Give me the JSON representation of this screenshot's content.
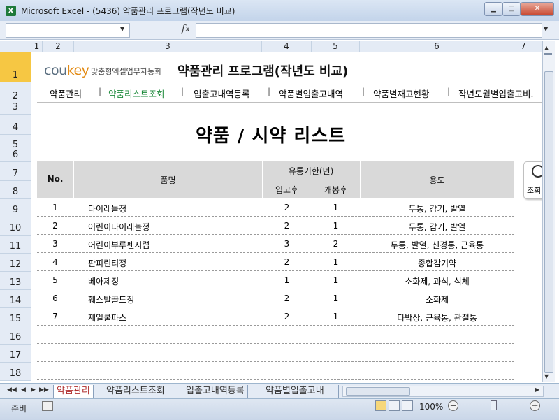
{
  "window": {
    "title": "Microsoft Excel - (5436) 약품관리 프로그램(작년도 비교)",
    "app_icon": "X",
    "min": "▁",
    "max": "□",
    "close": "✕"
  },
  "formula_bar": {
    "fx": "fx",
    "namebox": "",
    "value": ""
  },
  "columns": [
    "1",
    "2",
    "3",
    "4",
    "5",
    "6",
    "7"
  ],
  "rows": [
    "1",
    "2",
    "3",
    "4",
    "5",
    "6",
    "7",
    "8",
    "9",
    "10",
    "11",
    "12",
    "13",
    "14",
    "15",
    "16",
    "17",
    "18"
  ],
  "logo": {
    "brand_co": "cou",
    "brand_key": "key",
    "tagline": "맞춤형엑셀업무자동화"
  },
  "app_title": "약품관리 프로그램(작년도 비교)",
  "nav": [
    "약품관리",
    "약품리스트조회",
    "입출고내역등록",
    "약품별입출고내역",
    "약품별재고현황",
    "작년도월별입출고비."
  ],
  "nav_sep": "|",
  "heading": "약품 / 시약 리스트",
  "table": {
    "headers": {
      "no": "No.",
      "name": "품명",
      "expiry": "유통기한(년)",
      "after_receipt": "입고후",
      "after_open": "개봉후",
      "usage": "용도"
    },
    "rows": [
      {
        "no": "1",
        "name": "타이레놀정",
        "receipt": "2",
        "open": "1",
        "usage": "두통, 감기, 발열"
      },
      {
        "no": "2",
        "name": "어린이타이레놀정",
        "receipt": "2",
        "open": "1",
        "usage": "두통, 감기, 발열"
      },
      {
        "no": "3",
        "name": "어린이부루펜시럽",
        "receipt": "3",
        "open": "2",
        "usage": "두통, 발열, 신경통, 근육통"
      },
      {
        "no": "4",
        "name": "판피린티정",
        "receipt": "2",
        "open": "1",
        "usage": "종합감기약"
      },
      {
        "no": "5",
        "name": "베아제정",
        "receipt": "1",
        "open": "1",
        "usage": "소화제, 과식, 식체"
      },
      {
        "no": "6",
        "name": "훼스탈골드정",
        "receipt": "2",
        "open": "1",
        "usage": "소화제"
      },
      {
        "no": "7",
        "name": "제일쿨파스",
        "receipt": "2",
        "open": "1",
        "usage": "타박상, 근육통, 관절통"
      }
    ]
  },
  "search_button": {
    "label": "조회",
    "icon": "search-icon"
  },
  "sheet_tabs": [
    "약품관리",
    "약품리스트조회",
    "입출고내역등록",
    "약품별입출고내"
  ],
  "tab_nav": [
    "◀◀",
    "◀",
    "▶",
    "▶▶"
  ],
  "status": {
    "text": "준비",
    "zoom": "100%",
    "zoom_minus": "−",
    "zoom_plus": "+"
  },
  "colors": {
    "accent_green": "#1d8a3b",
    "header_gray": "#d9d9d9",
    "active_row": "#f6c743",
    "logo_orange": "#e28a13"
  }
}
